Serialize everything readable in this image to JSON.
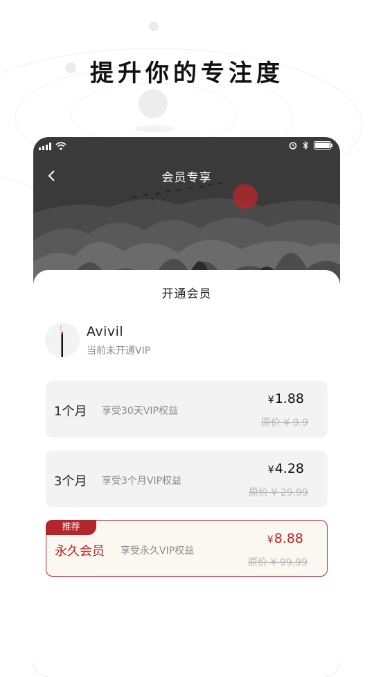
{
  "slogan": "提升你的专注度",
  "statusbar": {
    "signal_icon": "signal-bars-icon",
    "wifi_icon": "wifi-icon",
    "alarm_icon": "alarm-icon",
    "bluetooth_icon": "bluetooth-icon",
    "battery_icon": "battery-icon"
  },
  "header": {
    "back_icon": "chevron-left-icon",
    "title": "会员专享"
  },
  "sheet": {
    "title": "开通会员"
  },
  "user": {
    "name": "Avivil",
    "status": "当前未开通VIP"
  },
  "plans": [
    {
      "name": "1个月",
      "desc": "享受30天VIP权益",
      "currency": "¥",
      "price": "1.88",
      "original": "原价 ¥ 9.9",
      "recommended": false
    },
    {
      "name": "3个月",
      "desc": "享受3个月VIP权益",
      "currency": "¥",
      "price": "4.28",
      "original": "原价 ¥ 29.99",
      "recommended": false
    },
    {
      "name": "永久会员",
      "desc": "享受永久VIP权益",
      "currency": "¥",
      "price": "8.88",
      "original": "原价 ¥ 99.99",
      "recommended": true,
      "badge": "推荐"
    }
  ],
  "colors": {
    "accent": "#b3272c",
    "header_bg": "#3a3a3a",
    "card_bg": "#f3f3f3",
    "recommended_bg": "#fbf8f1",
    "sun": "#b3272c"
  }
}
